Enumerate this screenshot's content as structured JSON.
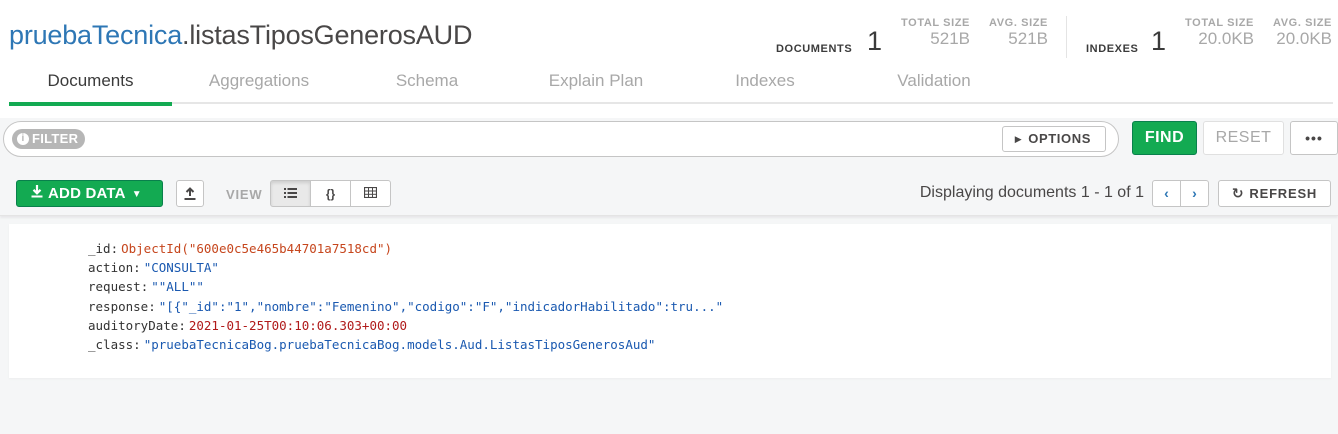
{
  "namespace": {
    "database": "pruebaTecnica",
    "separator": ".",
    "collection": "listasTiposGenerosAUD"
  },
  "stats": {
    "documents_label": "DOCUMENTS",
    "documents_count": "1",
    "doc_total_size_label": "TOTAL SIZE",
    "doc_total_size": "521B",
    "doc_avg_size_label": "AVG. SIZE",
    "doc_avg_size": "521B",
    "indexes_label": "INDEXES",
    "indexes_count": "1",
    "idx_total_size_label": "TOTAL SIZE",
    "idx_total_size": "20.0KB",
    "idx_avg_size_label": "AVG. SIZE",
    "idx_avg_size": "20.0KB"
  },
  "tabs": [
    {
      "label": "Documents",
      "active": true
    },
    {
      "label": "Aggregations"
    },
    {
      "label": "Schema"
    },
    {
      "label": "Explain Plan"
    },
    {
      "label": "Indexes"
    },
    {
      "label": "Validation"
    }
  ],
  "query": {
    "filter_label": "FILTER",
    "filter_value": "",
    "options_label": "OPTIONS",
    "find_label": "FIND",
    "reset_label": "RESET",
    "more_label": "•••"
  },
  "toolbar": {
    "add_data_label": "ADD DATA",
    "view_label": "VIEW",
    "view_modes": [
      "list",
      "json",
      "table"
    ],
    "active_view": "list",
    "displaying_text": "Displaying documents 1 - 1 of 1",
    "refresh_label": "REFRESH"
  },
  "document": [
    {
      "key": "_id",
      "value": "ObjectId(\"600e0c5e465b44701a7518cd\")",
      "type": "oid"
    },
    {
      "key": "action",
      "value": "\"CONSULTA\"",
      "type": "str"
    },
    {
      "key": "request",
      "value": "\"\"ALL\"\"",
      "type": "str"
    },
    {
      "key": "response",
      "value": "\"[{\"_id\":\"1\",\"nombre\":\"Femenino\",\"codigo\":\"F\",\"indicadorHabilitado\":tru...\"",
      "type": "str"
    },
    {
      "key": "auditoryDate",
      "value": "2021-01-25T00:10:06.303+00:00",
      "type": "date"
    },
    {
      "key": "_class",
      "value": "\"pruebaTecnicaBog.pruebaTecnicaBog.models.Aud.ListasTiposGenerosAud\"",
      "type": "str"
    }
  ],
  "colors": {
    "accent_green": "#13aa52",
    "link_blue": "#2e77b5",
    "oid_orange": "#c6461d",
    "string_blue": "#1a59b0",
    "date_red": "#b01a1a"
  }
}
